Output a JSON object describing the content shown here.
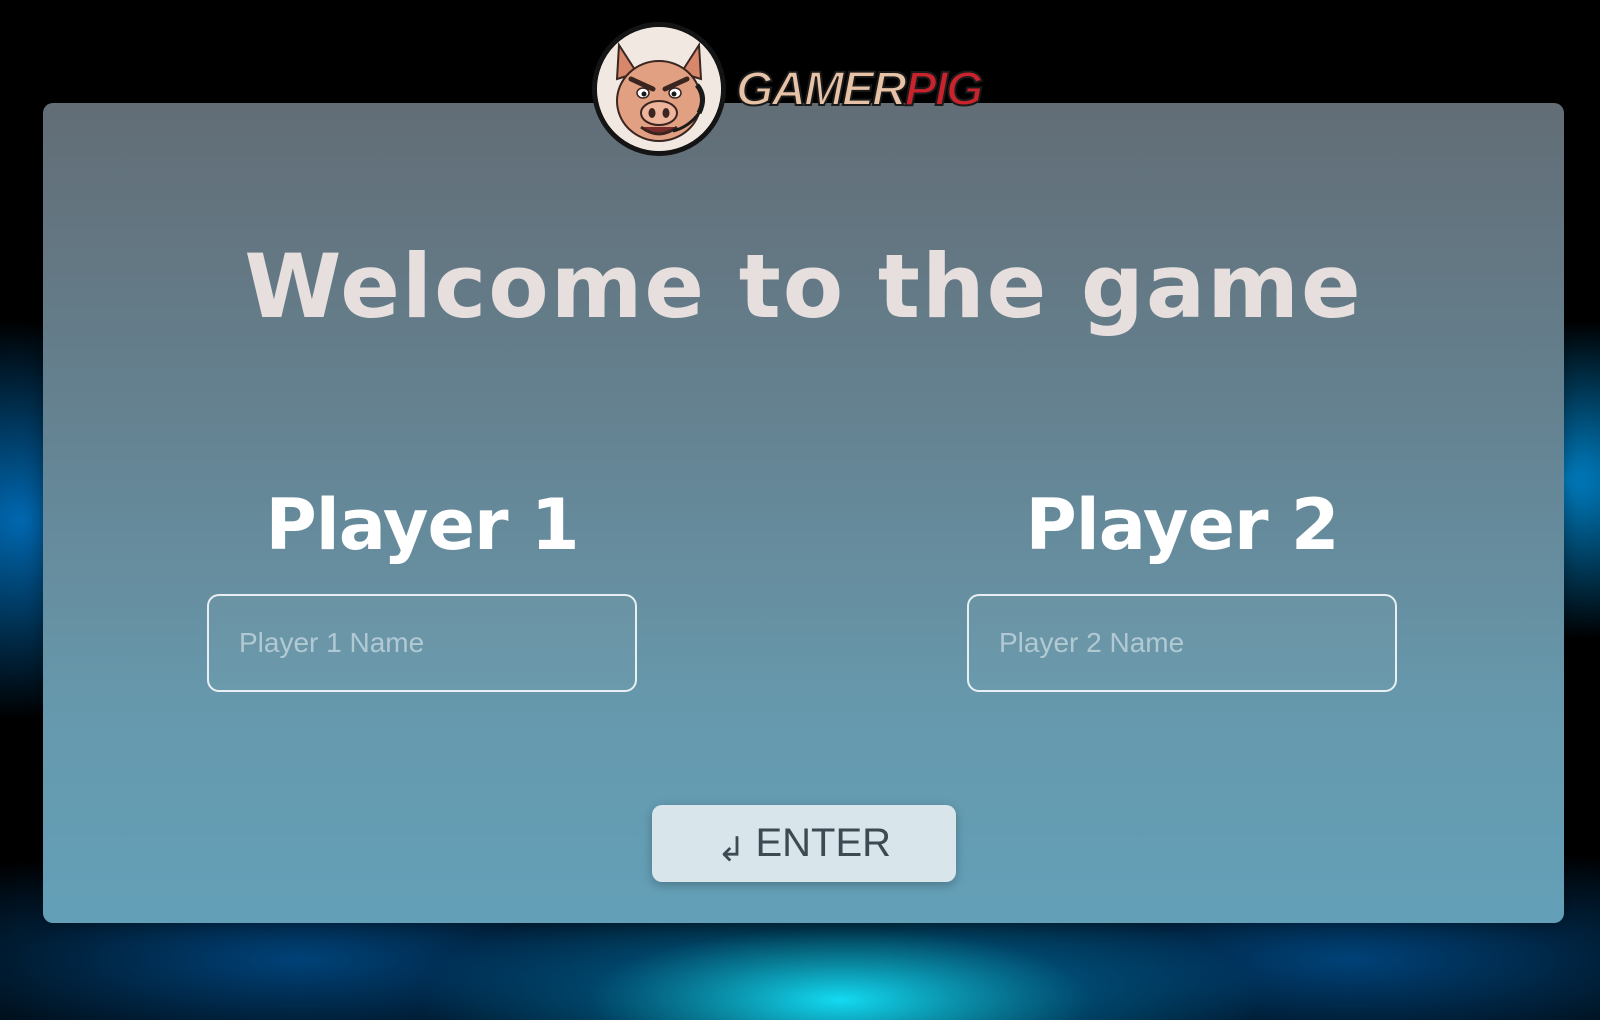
{
  "logo": {
    "word_part_1": "GAMER",
    "word_part_2": "PIG",
    "mascot_icon": "pig-mascot-icon",
    "colors": {
      "primary": "#e7c2a7",
      "accent": "#c9232e"
    }
  },
  "welcome": {
    "title": "Welcome to the game"
  },
  "players": [
    {
      "label": "Player 1",
      "input_value": "",
      "input_placeholder": "Player 1 Name"
    },
    {
      "label": "Player 2",
      "input_value": "",
      "input_placeholder": "Player 2 Name"
    }
  ],
  "enter_button": {
    "icon": "return-arrow-icon",
    "icon_glyph": "↲",
    "label": "ENTER"
  },
  "colors": {
    "panel_top": "#626d76",
    "panel_bottom": "#63a0b8",
    "title_text": "#e6dfde",
    "button_bg": "#d8e6ec",
    "background_glow": "#14e6ff"
  }
}
